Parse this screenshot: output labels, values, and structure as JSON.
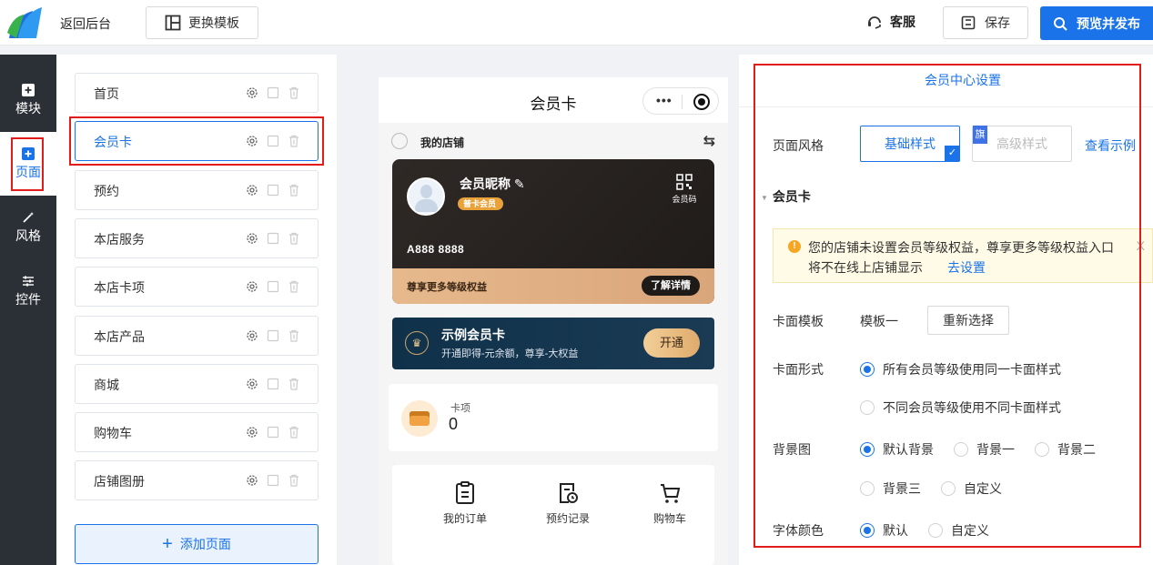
{
  "topbar": {
    "back_label": "返回后台",
    "template_label": "更换模板",
    "service_label": "客服",
    "save_label": "保存",
    "publish_label": "预览并发布"
  },
  "leftnav": {
    "items": [
      {
        "label": "模块",
        "icon": "plus-square-icon"
      },
      {
        "label": "页面",
        "icon": "plus-square-icon",
        "active": true
      },
      {
        "label": "风格",
        "icon": "magic-wand-icon"
      },
      {
        "label": "控件",
        "icon": "sliders-icon"
      }
    ]
  },
  "pages": {
    "items": [
      "首页",
      "会员卡",
      "预约",
      "本店服务",
      "本店卡项",
      "本店产品",
      "商城",
      "购物车",
      "店铺图册"
    ],
    "active": "会员卡",
    "add_label": "添加页面"
  },
  "phone": {
    "title": "会员卡",
    "capsule_dots": "•••",
    "store_label": "我的店铺",
    "store_switch": "⇆",
    "card": {
      "nickname": "会员昵称",
      "badge": "普卡会员",
      "qr_label": "会员码",
      "card_no": "A888 8888",
      "benefit_text": "尊享更多等级权益",
      "benefit_btn": "了解详情"
    },
    "sample": {
      "title": "示例会员卡",
      "subtitle": "开通即得-元余额，尊享-大权益",
      "open_btn": "开通",
      "crown": "♛"
    },
    "card_count": {
      "label": "卡项",
      "value": "0"
    },
    "quick": [
      "我的订单",
      "预约记录",
      "购物车"
    ]
  },
  "settings": {
    "title": "会员中心设置",
    "page_style_label": "页面风格",
    "style_basic": "基础样式",
    "style_advanced": "高级样式",
    "flag_text": "旗",
    "check_mark": "✓",
    "view_example": "查看示例",
    "section_title": "会员卡",
    "section_arrow": "▼",
    "notice_icon": "!",
    "notice_line1": "您的店铺未设置会员等级权益，尊享更多等级权益入口",
    "notice_line2": "将不在线上店铺显示",
    "notice_link": "去设置",
    "notice_close": "X",
    "card_template_label": "卡面模板",
    "card_template_value": "模板一",
    "reselect_label": "重新选择",
    "card_form_label": "卡面形式",
    "card_form_options": [
      "所有会员等级使用同一卡面样式",
      "不同会员等级使用不同卡面样式"
    ],
    "card_form_selected": 0,
    "bg_label": "背景图",
    "bg_options": [
      "默认背景",
      "背景一",
      "背景二",
      "背景三",
      "自定义"
    ],
    "bg_selected": 0,
    "font_color_label": "字体颜色",
    "font_color_options": [
      "默认",
      "自定义"
    ],
    "font_color_selected": 0
  },
  "colors": {
    "accent": "#1a73e8",
    "highlight_red": "#e21b1b",
    "nav_dark": "#2b2f36"
  }
}
